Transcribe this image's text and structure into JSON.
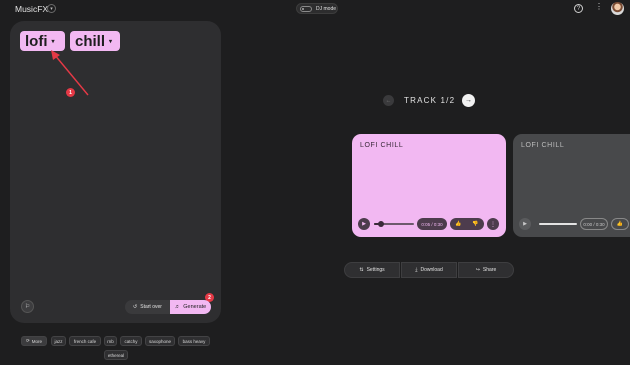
{
  "header": {
    "app_title": "MusicFX",
    "title_caret": "▾",
    "dj_mode_label": "DJ mode",
    "help_icon": "?",
    "more_icon": "⋮"
  },
  "prompt": {
    "chips": [
      {
        "label": "lofi",
        "caret": "▾"
      },
      {
        "label": "chill",
        "caret": "▾"
      }
    ],
    "markers": [
      "1",
      "2"
    ],
    "flag_icon": "⚐",
    "start_over_icon": "↺",
    "start_over_label": "Start over",
    "generate_icon": "♬",
    "generate_label": "Generate"
  },
  "suggestions": {
    "more_icon": "⟳",
    "more_label": "More",
    "items": [
      "jazz",
      "french cafe",
      "rnb",
      "catchy",
      "saxophone",
      "bass heavy",
      "ethereal"
    ]
  },
  "tracks": {
    "counter": "TRACK 1/2",
    "prev_icon": "←",
    "next_icon": "→",
    "cards": [
      {
        "title": "LOFI CHILL",
        "time": "0:05 / 0:30",
        "progress": 0.17,
        "play_icon": "▶",
        "like_icon": "👍",
        "dislike_icon": "👎",
        "more_icon": "⋮"
      },
      {
        "title": "LOFI CHILL",
        "time": "0:00 / 0:30",
        "progress": 0,
        "play_icon": "▶",
        "like_icon": "👍"
      }
    ]
  },
  "actions": {
    "settings_icon": "⇅",
    "settings_label": "Settings",
    "download_icon": "⤓",
    "download_label": "Download",
    "share_icon": "↪",
    "share_label": "Share"
  },
  "colors": {
    "accent": "#f2b8f2",
    "annotation": "#e53946",
    "background": "#1e1e1f"
  }
}
